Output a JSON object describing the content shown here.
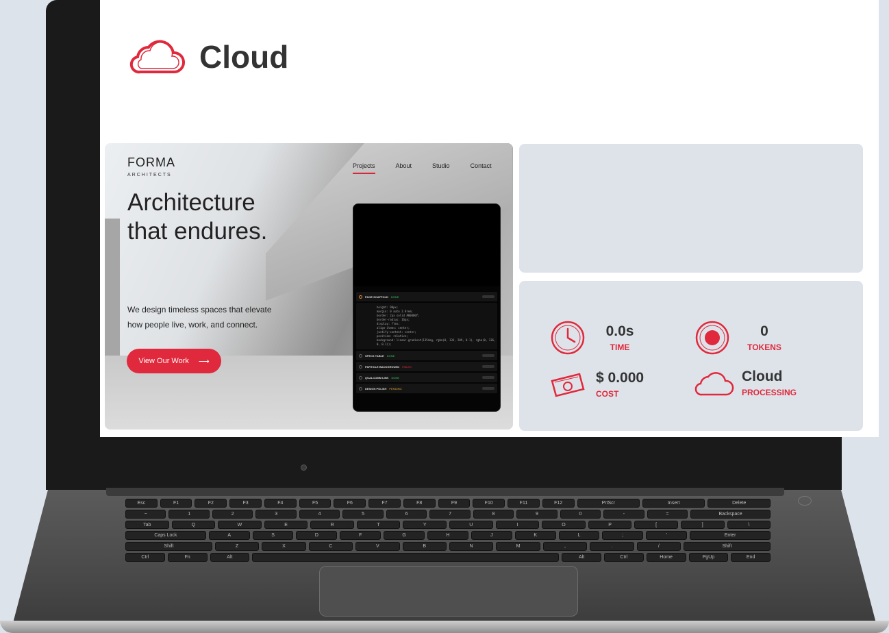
{
  "app": {
    "title": "Cloud",
    "brand_icon": "cloud-outline-icon",
    "accent_color": "#e0293c"
  },
  "preview": {
    "logo": "FORMA",
    "logo_sub": "ARCHITECTS",
    "nav": [
      {
        "label": "Projects",
        "active": true
      },
      {
        "label": "About",
        "active": false
      },
      {
        "label": "Studio",
        "active": false
      },
      {
        "label": "Contact",
        "active": false
      }
    ],
    "hero_line1": "Architecture",
    "hero_line2": "that endures.",
    "description_line1": "We design timeless spaces that elevate",
    "description_line2": "how people live, work, and connect.",
    "cta_label": "View Our Work",
    "cta_arrow": "⟶"
  },
  "task_panel": {
    "items": [
      {
        "label": "PAGE SCAFFOLD",
        "status": "DONE",
        "status_type": "done"
      },
      {
        "label": "SPECS TABLE",
        "status": "DONE",
        "status_type": "done"
      },
      {
        "label": "PARTICLE BACKGROUND",
        "status": "FAILED",
        "status_type": "fail"
      },
      {
        "label": "QUALCOMM LINK",
        "status": "DONE",
        "status_type": "done"
      },
      {
        "label": "DESIGN POLISH",
        "status": "PENDING",
        "status_type": "pending"
      }
    ],
    "code": "height: 90px;\nmargin: 0 auto 2.0rem;\nborder: 2px solid #00000f;\nborder-radius: 16px;\ndisplay: flex;\nalign-items: center;\njustify-content: center;\nposition: relative;\nbackground: linear-gradient(135deg, rgba(0, 136, 209, 0.1), rgba(0, 136, 2\n0, 0.1));"
  },
  "stats": {
    "time": {
      "value": "0.0s",
      "label": "TIME",
      "icon": "clock-icon"
    },
    "tokens": {
      "value": "0",
      "label": "TOKENS",
      "icon": "record-icon"
    },
    "cost": {
      "value": "$ 0.000",
      "label": "COST",
      "icon": "money-icon"
    },
    "mode": {
      "value": "Cloud",
      "label": "PROCESSING",
      "icon": "cloud-icon"
    }
  },
  "keyboard": {
    "rows": [
      [
        "Esc",
        "F1",
        "F2",
        "F3",
        "F4",
        "F5",
        "F6",
        "F7",
        "F8",
        "F9",
        "F10",
        "F11",
        "F12",
        "PrtScr",
        "Insert",
        "Delete"
      ],
      [
        "~",
        "1",
        "2",
        "3",
        "4",
        "5",
        "6",
        "7",
        "8",
        "9",
        "0",
        "-",
        "=",
        "Backspace"
      ],
      [
        "Tab",
        "Q",
        "W",
        "E",
        "R",
        "T",
        "Y",
        "U",
        "I",
        "O",
        "P",
        "[",
        "]",
        "\\"
      ],
      [
        "Caps Lock",
        "A",
        "S",
        "D",
        "F",
        "G",
        "H",
        "J",
        "K",
        "L",
        ";",
        "'",
        "Enter"
      ],
      [
        "Shift",
        "Z",
        "X",
        "C",
        "V",
        "B",
        "N",
        "M",
        ",",
        ".",
        "/",
        "Shift"
      ],
      [
        "Ctrl",
        "Fn",
        "Alt",
        "",
        "Alt",
        "Ctrl",
        "Home",
        "PgUp",
        "End"
      ]
    ]
  }
}
